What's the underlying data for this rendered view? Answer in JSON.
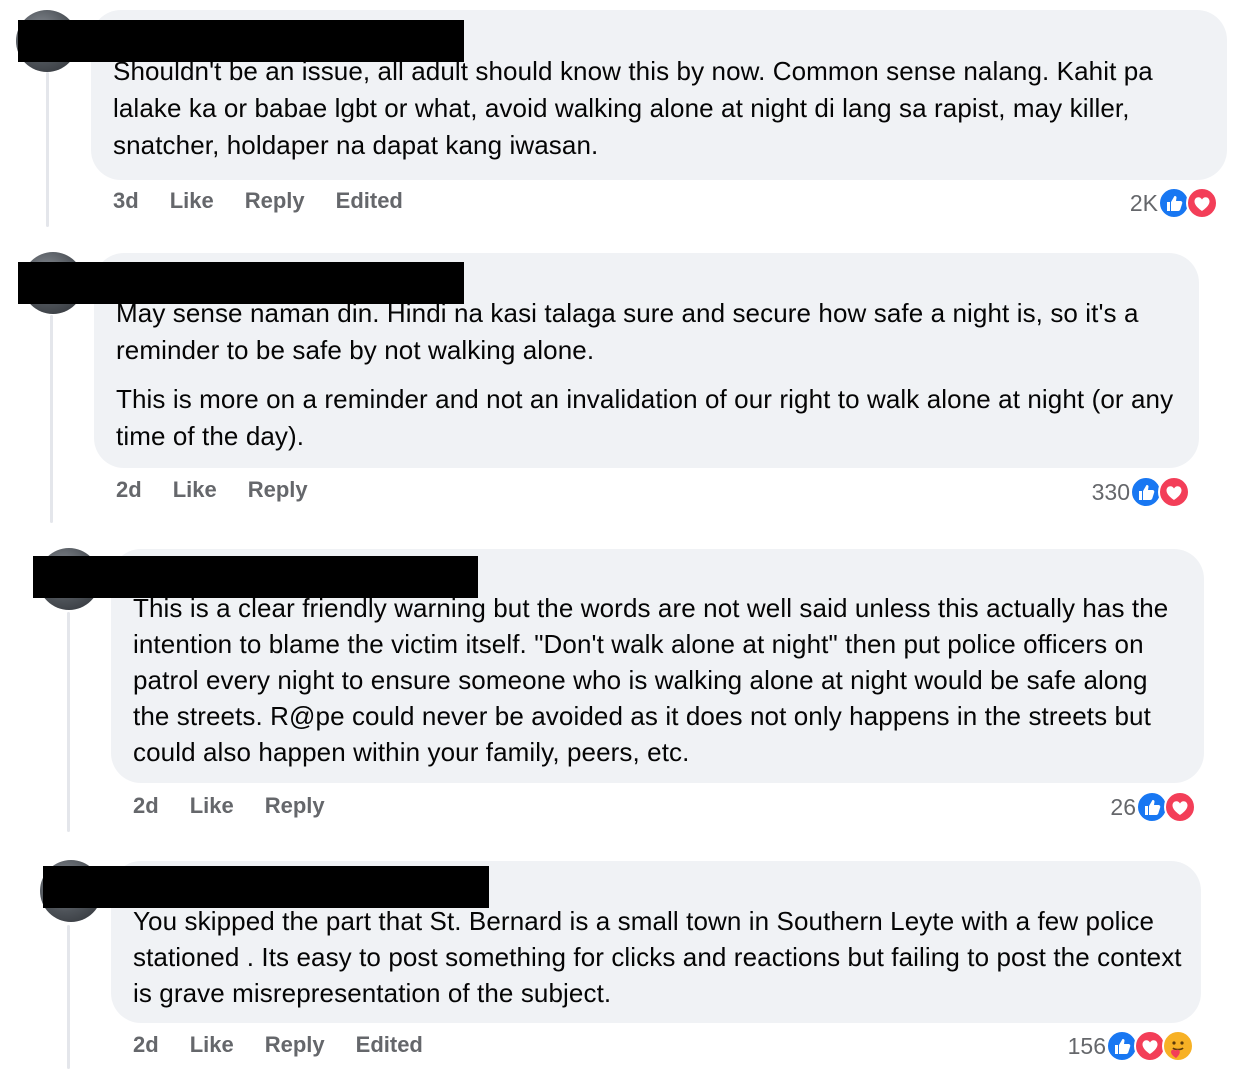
{
  "comments": [
    {
      "paragraphs": [
        "Shouldn't be an issue, all adult should know this by now. Common sense nalang. Kahit pa lalake ka or babae lgbt or what, avoid walking alone at night di lang sa rapist, may killer, snatcher, holdaper na dapat kang iwasan."
      ],
      "actions": {
        "time": "3d",
        "like": "Like",
        "reply": "Reply",
        "edited": "Edited"
      },
      "reaction_count": "2K",
      "reactions": [
        "like-icon",
        "love-icon"
      ]
    },
    {
      "paragraphs": [
        "May sense naman din. Hindi na kasi talaga sure and secure how safe a night is, so it's a reminder to be safe by not walking alone.",
        "This is more on a reminder and not an invalidation of our right to walk alone at night (or any time of the day)."
      ],
      "actions": {
        "time": "2d",
        "like": "Like",
        "reply": "Reply"
      },
      "reaction_count": "330",
      "reactions": [
        "like-icon",
        "love-icon"
      ]
    },
    {
      "paragraphs": [
        "This is a clear friendly warning but the words are not well said unless this actually has the intention to blame the victim itself. \"Don't walk alone at night\" then put police officers on patrol every night to ensure someone who is walking alone at night would be safe along the streets. R@pe could never be avoided as it does not only happens in the streets but could also happen within your family, peers, etc."
      ],
      "actions": {
        "time": "2d",
        "like": "Like",
        "reply": "Reply"
      },
      "reaction_count": "26",
      "reactions": [
        "like-icon",
        "love-icon"
      ]
    },
    {
      "paragraphs": [
        "You skipped the part that St. Bernard is a small town in Southern Leyte with a few police stationed . Its easy to post something for clicks and reactions but failing to post the context is grave misrepresentation of the subject."
      ],
      "actions": {
        "time": "2d",
        "like": "Like",
        "reply": "Reply",
        "edited": "Edited"
      },
      "reaction_count": "156",
      "reactions": [
        "like-icon",
        "love-icon",
        "care-icon"
      ]
    }
  ],
  "colors": {
    "bubble_bg": "#f0f2f5",
    "action_text": "#65676b",
    "like_blue": "#1877f2",
    "love_red": "#f33e58",
    "care_yellow": "#f7b125"
  }
}
